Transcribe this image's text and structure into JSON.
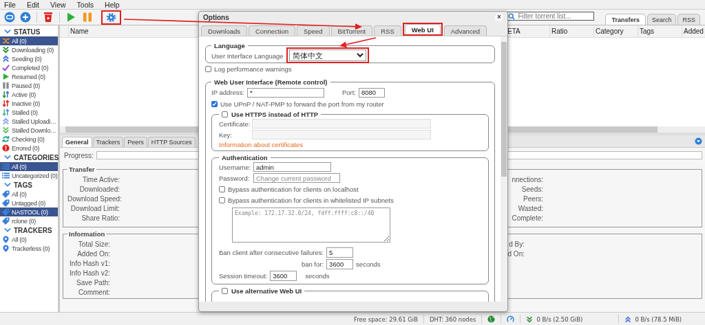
{
  "menu": [
    "File",
    "Edit",
    "View",
    "Tools",
    "Help"
  ],
  "toolbar": {
    "filter_placeholder": "Filter torrent list...",
    "tabs": [
      {
        "label": "Transfers",
        "selected": true
      },
      {
        "label": "Search",
        "selected": false
      },
      {
        "label": "RSS",
        "selected": false
      }
    ]
  },
  "sidebar": {
    "sections": [
      {
        "title": "STATUS",
        "expanded": true,
        "items": [
          {
            "label": "All (0)",
            "selected": true
          },
          {
            "label": "Downloading (0)",
            "selected": false
          },
          {
            "label": "Seeding (0)",
            "selected": false
          },
          {
            "label": "Completed (0)",
            "selected": false
          },
          {
            "label": "Resumed (0)",
            "selected": false
          },
          {
            "label": "Paused (0)",
            "selected": false
          },
          {
            "label": "Active (0)",
            "selected": false
          },
          {
            "label": "Inactive (0)",
            "selected": false
          },
          {
            "label": "Stalled (0)",
            "selected": false
          },
          {
            "label": "Stalled Uploadi…",
            "selected": false
          },
          {
            "label": "Stalled Downlo…",
            "selected": false
          },
          {
            "label": "Checking (0)",
            "selected": false
          },
          {
            "label": "Errored (0)",
            "selected": false
          }
        ]
      },
      {
        "title": "CATEGORIES",
        "expanded": true,
        "items": [
          {
            "label": "All (0)",
            "selected": true
          },
          {
            "label": "Uncategorized (0)",
            "selected": false
          }
        ]
      },
      {
        "title": "TAGS",
        "expanded": true,
        "items": [
          {
            "label": "All (0)",
            "selected": false
          },
          {
            "label": "Untagged (0)",
            "selected": false
          },
          {
            "label": "NASTOOL (0)",
            "selected": true
          },
          {
            "label": "rclone (0)",
            "selected": false
          }
        ]
      },
      {
        "title": "TRACKERS",
        "expanded": true,
        "items": [
          {
            "label": "All (0)",
            "selected": false
          },
          {
            "label": "Trackerless (0)",
            "selected": false
          }
        ]
      }
    ]
  },
  "torrent_table": {
    "columns": [
      "Name",
      "ETA",
      "Ratio",
      "Category",
      "Tags",
      "Added"
    ]
  },
  "details": {
    "tabs": [
      {
        "label": "General",
        "selected": true
      },
      {
        "label": "Trackers",
        "selected": false
      },
      {
        "label": "Peers",
        "selected": false
      },
      {
        "label": "HTTP Sources",
        "selected": false
      }
    ],
    "progress": {
      "label": "Progress:",
      "level": 0
    },
    "transfer": {
      "title": "Transfer",
      "labels": [
        "Time Active:",
        "Downloaded:",
        "Download Speed:",
        "Download Limit:",
        "Share Ratio:"
      ],
      "right_labels": [
        "nnections:",
        "Seeds:",
        "Peers:",
        "Wasted:",
        "Complete:"
      ]
    },
    "information": {
      "title": "Information",
      "labels": [
        "Total Size:",
        "Added On:",
        "Info Hash v1:",
        "Info Hash v2:",
        "Save Path:",
        "Comment:"
      ],
      "right_labels": [
        "d By:",
        "d On:"
      ]
    }
  },
  "status_bar": {
    "free_space": "Free space: 29.61 GiB",
    "dht": "DHT: 360 nodes",
    "download": "0 B/s (2.50 GiB)",
    "upload": "0 B/s (78.5 MiB)"
  },
  "options_dialog": {
    "title": "Options",
    "close": "×",
    "tabs": [
      {
        "label": "Downloads",
        "selected": false
      },
      {
        "label": "Connection",
        "selected": false
      },
      {
        "label": "Speed",
        "selected": false
      },
      {
        "label": "BitTorrent",
        "selected": false
      },
      {
        "label": "RSS",
        "selected": false
      },
      {
        "label": "Web UI",
        "selected": true
      },
      {
        "label": "Advanced",
        "selected": false
      }
    ],
    "language": {
      "legend": "Language",
      "label": "User Interface Language",
      "value": "简体中文"
    },
    "log_performance": {
      "label": "Log performance warnings",
      "checked": false
    },
    "web_ui": {
      "legend": "Web User Interface (Remote control)",
      "ip_label": "IP address:",
      "ip_value": "*",
      "port_label": "Port:",
      "port_value": "8080",
      "upnp": {
        "label": "Use UPnP / NAT-PMP to forward the port from my router",
        "checked": true
      },
      "https": {
        "label": "Use HTTPS instead of HTTP",
        "checked": false,
        "certificate_label": "Certificate:",
        "key_label": "Key:",
        "info_link": "Information about certificates"
      },
      "authentication": {
        "legend": "Authentication",
        "username_label": "Username:",
        "username_value": "admin",
        "password_label": "Password:",
        "password_placeholder": "Change current password",
        "bypass_localhost": {
          "label": "Bypass authentication for clients on localhost",
          "checked": false
        },
        "bypass_whitelist": {
          "label": "Bypass authentication for clients in whitelisted IP subnets",
          "checked": false
        },
        "subnets_placeholder": "Example: 172.17.32.0/24, fdff:ffff:c8::/40",
        "ban_label": "Ban client after consecutive failures:",
        "ban_value": "5",
        "ban_for_label": "ban for:",
        "ban_for_value": "3600",
        "ban_for_unit": "seconds",
        "session_label": "Session timeout:",
        "session_value": "3600",
        "session_unit": "seconds"
      },
      "alternative": {
        "label": "Use alternative Web UI",
        "checked": false
      }
    }
  }
}
